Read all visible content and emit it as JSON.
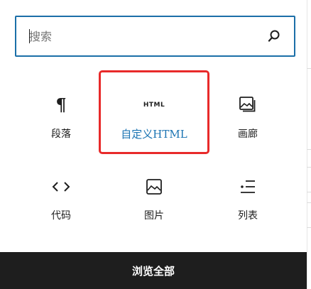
{
  "search": {
    "placeholder": "搜索",
    "value": ""
  },
  "blocks": [
    {
      "label": "段落",
      "icon": "paragraph-icon"
    },
    {
      "label": "自定义HTML",
      "icon": "html-icon",
      "glyph": "HTML",
      "active": true
    },
    {
      "label": "画廊",
      "icon": "gallery-icon"
    },
    {
      "label": "代码",
      "icon": "code-icon"
    },
    {
      "label": "图片",
      "icon": "image-icon"
    },
    {
      "label": "列表",
      "icon": "list-icon"
    }
  ],
  "footer": {
    "label": "浏览全部"
  },
  "colors": {
    "accent": "#1b6fa8",
    "active_label": "#1b74b3",
    "highlight": "#e82a2a",
    "footer_bg": "#1e1e1e"
  }
}
